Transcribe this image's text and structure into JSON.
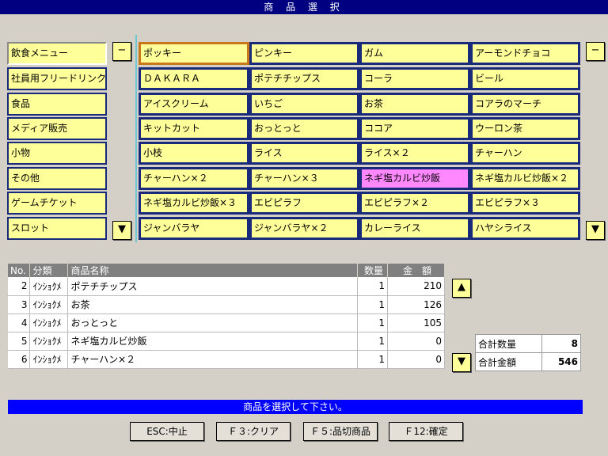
{
  "title": "商 品 選 択",
  "categories": [
    {
      "label": "飲食メニュー"
    },
    {
      "label": "社員用フリードリンク"
    },
    {
      "label": "食品"
    },
    {
      "label": "メディア販売"
    },
    {
      "label": "小物"
    },
    {
      "label": "その他"
    },
    {
      "label": "ゲームチケット"
    },
    {
      "label": "スロット"
    }
  ],
  "products": [
    [
      "ポッキー",
      "ピンキー",
      "ガム",
      "アーモンドチョコ"
    ],
    [
      "ＤＡＫＡＲＡ",
      "ポテチチップス",
      "コーラ",
      "ビール"
    ],
    [
      "アイスクリーム",
      "いちご",
      "お茶",
      "コアラのマーチ"
    ],
    [
      "キットカット",
      "おっとっと",
      "ココア",
      "ウーロン茶"
    ],
    [
      "小枝",
      "ライス",
      "ライス×２",
      "チャーハン"
    ],
    [
      "チャーハン×２",
      "チャーハン×３",
      "ネギ塩カルビ炒飯",
      "ネギ塩カルビ炒飯×２"
    ],
    [
      "ネギ塩カルビ炒飯×３",
      "エビピラフ",
      "エビピラフ×２",
      "エビピラフ×３"
    ],
    [
      "ジャンバラヤ",
      "ジャンバラヤ×２",
      "カレーライス",
      "ハヤシライス"
    ]
  ],
  "buttons": {
    "minus": "−",
    "down": "▼",
    "up": "▲"
  },
  "table": {
    "headers": [
      "No.",
      "分類",
      "商品名称",
      "数量",
      "金　額"
    ],
    "rows": [
      {
        "no": "2",
        "cat": "ｲﾝｼｮｸﾒ",
        "name": "ポテチチップス",
        "qty": "1",
        "amount": "210"
      },
      {
        "no": "3",
        "cat": "ｲﾝｼｮｸﾒ",
        "name": "お茶",
        "qty": "1",
        "amount": "126"
      },
      {
        "no": "4",
        "cat": "ｲﾝｼｮｸﾒ",
        "name": "おっとっと",
        "qty": "1",
        "amount": "105"
      },
      {
        "no": "5",
        "cat": "ｲﾝｼｮｸﾒ",
        "name": "ネギ塩カルビ炒飯",
        "qty": "1",
        "amount": "0"
      },
      {
        "no": "6",
        "cat": "ｲﾝｼｮｸﾒ",
        "name": "チャーハン×２",
        "qty": "1",
        "amount": "0"
      }
    ]
  },
  "summary": {
    "qty_label": "合計数量",
    "qty_value": "8",
    "amount_label": "合計金額",
    "amount_value": "546"
  },
  "status": "商品を選択して下さい。",
  "fkeys": [
    "ESC:中止",
    "Ｆ３:クリア",
    "Ｆ５:品切商品",
    "Ｆ12:確定"
  ],
  "colors": {
    "button": "#ffff99",
    "button_border": "#1a2a7a",
    "highlight": "#ff88ff",
    "title_bg": "#000080",
    "status_bg": "#0000ff"
  }
}
